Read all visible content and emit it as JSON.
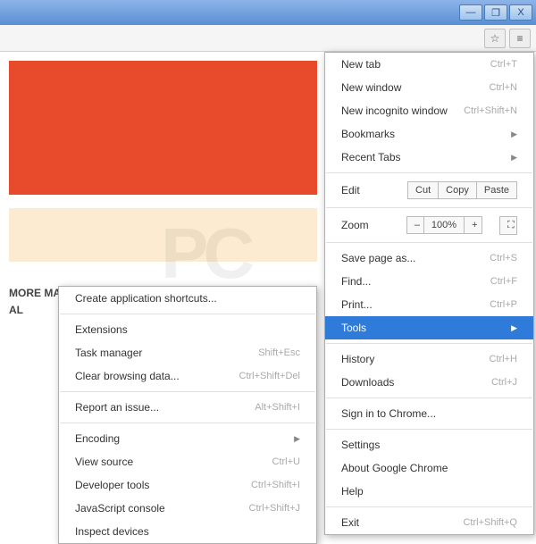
{
  "titlebar": {
    "min": "—",
    "max": "❐",
    "close": "X"
  },
  "toolbar": {
    "star": "☆",
    "menu": "≡"
  },
  "page": {
    "headline1": "MORE MANAGEABLE WITH THE NEW savi",
    "headline2": "AL"
  },
  "main": {
    "newtab": {
      "l": "New tab",
      "s": "Ctrl+T"
    },
    "newwin": {
      "l": "New window",
      "s": "Ctrl+N"
    },
    "incog": {
      "l": "New incognito window",
      "s": "Ctrl+Shift+N"
    },
    "bookmarks": {
      "l": "Bookmarks"
    },
    "recent": {
      "l": "Recent Tabs"
    },
    "edit": {
      "l": "Edit",
      "cut": "Cut",
      "copy": "Copy",
      "paste": "Paste"
    },
    "zoom": {
      "l": "Zoom",
      "minus": "–",
      "val": "100%",
      "plus": "+",
      "full": "⛶"
    },
    "save": {
      "l": "Save page as...",
      "s": "Ctrl+S"
    },
    "find": {
      "l": "Find...",
      "s": "Ctrl+F"
    },
    "print": {
      "l": "Print...",
      "s": "Ctrl+P"
    },
    "tools": {
      "l": "Tools"
    },
    "history": {
      "l": "History",
      "s": "Ctrl+H"
    },
    "downloads": {
      "l": "Downloads",
      "s": "Ctrl+J"
    },
    "signin": {
      "l": "Sign in to Chrome..."
    },
    "settings": {
      "l": "Settings"
    },
    "about": {
      "l": "About Google Chrome"
    },
    "help": {
      "l": "Help"
    },
    "exit": {
      "l": "Exit",
      "s": "Ctrl+Shift+Q"
    }
  },
  "sub": {
    "shortcuts": {
      "l": "Create application shortcuts..."
    },
    "ext": {
      "l": "Extensions"
    },
    "task": {
      "l": "Task manager",
      "s": "Shift+Esc"
    },
    "clear": {
      "l": "Clear browsing data...",
      "s": "Ctrl+Shift+Del"
    },
    "report": {
      "l": "Report an issue...",
      "s": "Alt+Shift+I"
    },
    "encoding": {
      "l": "Encoding"
    },
    "source": {
      "l": "View source",
      "s": "Ctrl+U"
    },
    "devtools": {
      "l": "Developer tools",
      "s": "Ctrl+Shift+I"
    },
    "jsconsole": {
      "l": "JavaScript console",
      "s": "Ctrl+Shift+J"
    },
    "inspect": {
      "l": "Inspect devices"
    }
  },
  "wm": "PC"
}
